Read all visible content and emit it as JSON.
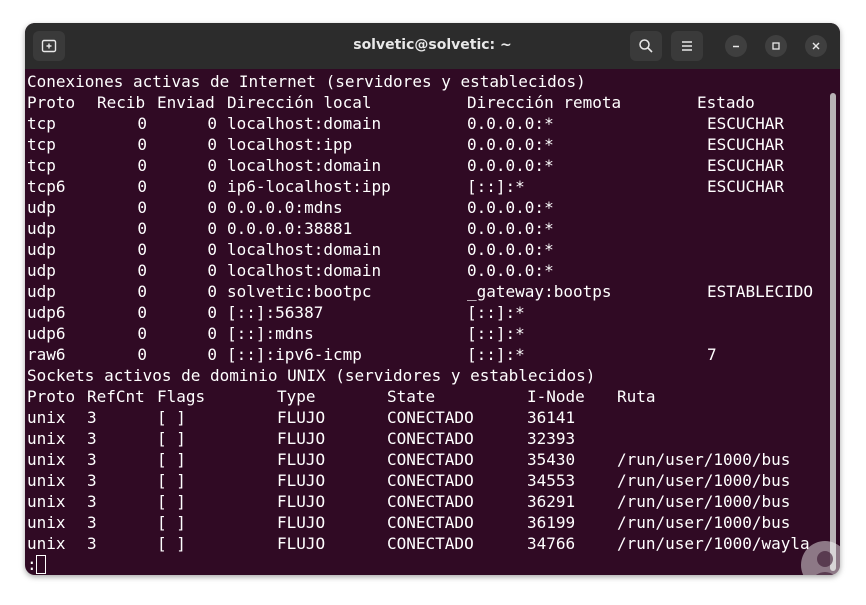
{
  "window": {
    "title": "solvetic@solvetic: ~"
  },
  "icons": {
    "new_tab": "new-tab-icon",
    "search": "search-icon",
    "menu": "hamburger-menu-icon",
    "minimize": "minimize-icon",
    "maximize": "maximize-icon",
    "close": "close-icon"
  },
  "colors": {
    "terminal_bg": "#300a24",
    "titlebar_bg": "#2c2c2c",
    "text": "#ffffff"
  },
  "internet": {
    "header": "Conexiones activas de Internet (servidores y establecidos)",
    "columns": {
      "proto": "Proto",
      "recib": "Recib",
      "enviad": "Enviad",
      "local": "Dirección local",
      "remote": "Dirección remota",
      "state": "Estado"
    },
    "rows": [
      {
        "proto": "tcp",
        "recib": "0",
        "enviad": "0",
        "local": "localhost:domain",
        "remote": "0.0.0.0:*",
        "state": "ESCUCHAR"
      },
      {
        "proto": "tcp",
        "recib": "0",
        "enviad": "0",
        "local": "localhost:ipp",
        "remote": "0.0.0.0:*",
        "state": "ESCUCHAR"
      },
      {
        "proto": "tcp",
        "recib": "0",
        "enviad": "0",
        "local": "localhost:domain",
        "remote": "0.0.0.0:*",
        "state": "ESCUCHAR"
      },
      {
        "proto": "tcp6",
        "recib": "0",
        "enviad": "0",
        "local": "ip6-localhost:ipp",
        "remote": "[::]:*",
        "state": "ESCUCHAR"
      },
      {
        "proto": "udp",
        "recib": "0",
        "enviad": "0",
        "local": "0.0.0.0:mdns",
        "remote": "0.0.0.0:*",
        "state": ""
      },
      {
        "proto": "udp",
        "recib": "0",
        "enviad": "0",
        "local": "0.0.0.0:38881",
        "remote": "0.0.0.0:*",
        "state": ""
      },
      {
        "proto": "udp",
        "recib": "0",
        "enviad": "0",
        "local": "localhost:domain",
        "remote": "0.0.0.0:*",
        "state": ""
      },
      {
        "proto": "udp",
        "recib": "0",
        "enviad": "0",
        "local": "localhost:domain",
        "remote": "0.0.0.0:*",
        "state": ""
      },
      {
        "proto": "udp",
        "recib": "0",
        "enviad": "0",
        "local": "solvetic:bootpc",
        "remote": "_gateway:bootps",
        "state": "ESTABLECIDO"
      },
      {
        "proto": "udp6",
        "recib": "0",
        "enviad": "0",
        "local": "[::]:56387",
        "remote": "[::]:*",
        "state": ""
      },
      {
        "proto": "udp6",
        "recib": "0",
        "enviad": "0",
        "local": "[::]:mdns",
        "remote": "[::]:*",
        "state": ""
      },
      {
        "proto": "raw6",
        "recib": "0",
        "enviad": "0",
        "local": "[::]:ipv6-icmp",
        "remote": "[::]:*",
        "state": "7"
      }
    ]
  },
  "unix": {
    "header": "Sockets activos de dominio UNIX (servidores y establecidos)",
    "columns": {
      "proto": "Proto",
      "refcnt": "RefCnt",
      "flags": "Flags",
      "type": "Type",
      "state": "State",
      "inode": "I-Node",
      "path": "Ruta"
    },
    "rows": [
      {
        "proto": "unix",
        "refcnt": "3",
        "flags": "[ ]",
        "type": "FLUJO",
        "state": "CONECTADO",
        "inode": "36141",
        "path": ""
      },
      {
        "proto": "unix",
        "refcnt": "3",
        "flags": "[ ]",
        "type": "FLUJO",
        "state": "CONECTADO",
        "inode": "32393",
        "path": ""
      },
      {
        "proto": "unix",
        "refcnt": "3",
        "flags": "[ ]",
        "type": "FLUJO",
        "state": "CONECTADO",
        "inode": "35430",
        "path": "/run/user/1000/bus"
      },
      {
        "proto": "unix",
        "refcnt": "3",
        "flags": "[ ]",
        "type": "FLUJO",
        "state": "CONECTADO",
        "inode": "34553",
        "path": "/run/user/1000/bus"
      },
      {
        "proto": "unix",
        "refcnt": "3",
        "flags": "[ ]",
        "type": "FLUJO",
        "state": "CONECTADO",
        "inode": "36291",
        "path": "/run/user/1000/bus"
      },
      {
        "proto": "unix",
        "refcnt": "3",
        "flags": "[ ]",
        "type": "FLUJO",
        "state": "CONECTADO",
        "inode": "36199",
        "path": "/run/user/1000/bus"
      },
      {
        "proto": "unix",
        "refcnt": "3",
        "flags": "[ ]",
        "type": "FLUJO",
        "state": "CONECTADO",
        "inode": "34766",
        "path": "/run/user/1000/wayla"
      }
    ]
  },
  "prompt": ":"
}
